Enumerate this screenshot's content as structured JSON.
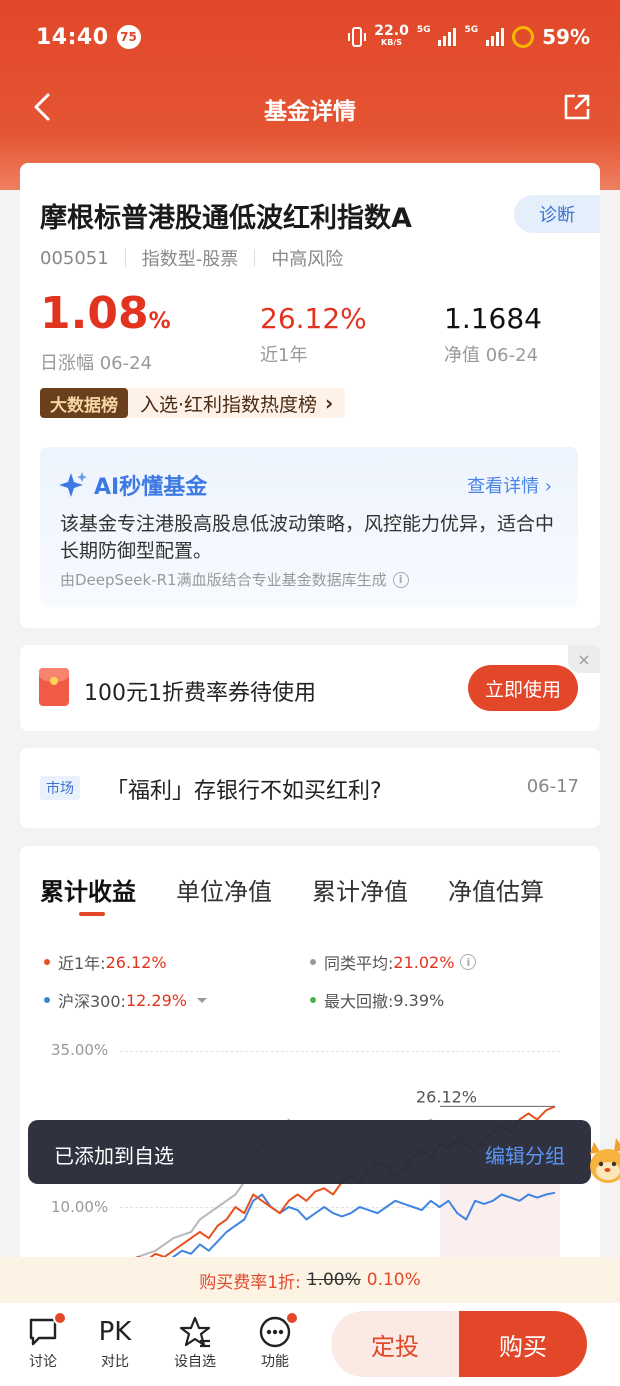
{
  "status_bar": {
    "time": "14:40",
    "notif_count": "75",
    "net_speed": "22.0",
    "net_unit": "KB/S",
    "sim1": "5G",
    "sim2": "5G",
    "battery": "59%"
  },
  "nav": {
    "title": "基金详情",
    "back_icon": "back-arrow-icon",
    "share_icon": "share-icon"
  },
  "fund": {
    "name": "摩根标普港股通低波红利指数A",
    "diagnose_label": "诊断",
    "code": "005051",
    "type": "指数型-股票",
    "risk": "中高风险",
    "daily_change_value": "1.08",
    "daily_change_unit": "%",
    "daily_change_label": "日涨幅 06-24",
    "one_year_value": "26.12%",
    "one_year_label": "近1年",
    "nav_value": "1.1684",
    "nav_label": "净值 06-24",
    "rank_tag": "大数据榜",
    "rank_text": "入选·红利指数热度榜",
    "rank_arrow": "›"
  },
  "ai": {
    "title": "AI秒懂基金",
    "more": "查看详情 ›",
    "body": "该基金专注港股高股息低波动策略，风控能力优异，适合中长期防御型配置。",
    "source": "由DeepSeek-R1满血版结合专业基金数据库生成"
  },
  "coupon": {
    "text": "100元1折费率券待使用",
    "button": "立即使用",
    "close": "×"
  },
  "news": {
    "tag": "市场",
    "title": "「福利」存银行不如买红利?",
    "date": "06-17"
  },
  "chart_tabs": [
    "累计收益",
    "单位净值",
    "累计净值",
    "净值估算"
  ],
  "legend": {
    "near_year_label": "近1年:",
    "near_year_value": "26.12%",
    "peer_avg_label": "同类平均:",
    "peer_avg_value": "21.02%",
    "hs300_label": "沪深300:",
    "hs300_value": "12.29%",
    "max_dd_label": "最大回撤:",
    "max_dd_value": "9.39%"
  },
  "chart_data": {
    "type": "line",
    "yticks": [
      "35.00%",
      "10.00%"
    ],
    "yticks_values": [
      35,
      22.5,
      10
    ],
    "ylim": [
      0,
      35
    ],
    "end_label": "26.12%",
    "series": [
      {
        "name": "近1年",
        "color": "#e8511f",
        "values": [
          0.5,
          1,
          2,
          1.5,
          2.5,
          2,
          3,
          4,
          5,
          6,
          5,
          7,
          8,
          10,
          9,
          12,
          11,
          10,
          9,
          11,
          12,
          11,
          12.5,
          13,
          12,
          14,
          15,
          14,
          16,
          17,
          16.5,
          15,
          16,
          18,
          19,
          18,
          20,
          19.5,
          21,
          20,
          19,
          20.5,
          22,
          23,
          22,
          24,
          25,
          24,
          25.5,
          26.12
        ]
      },
      {
        "name": "同类平均",
        "color": "#b8b8b8",
        "values": [
          0.5,
          1.5,
          2,
          2.5,
          3,
          4,
          5,
          5.5,
          6,
          8,
          9,
          10,
          11,
          12,
          14,
          18,
          20,
          19,
          22,
          24,
          20,
          18,
          16,
          17,
          18,
          19,
          17,
          16,
          18,
          17,
          19,
          20,
          22,
          21,
          23,
          24,
          22,
          21,
          20,
          22,
          21,
          20,
          19,
          18,
          19,
          21,
          20,
          21,
          21,
          21.02
        ]
      },
      {
        "name": "沪深300",
        "color": "#3f85e0",
        "values": [
          0,
          0.5,
          1,
          0.5,
          1.5,
          1,
          2,
          3,
          2.5,
          4,
          3,
          4.5,
          6,
          7,
          8,
          11,
          12,
          10,
          9,
          10,
          9.5,
          8,
          9,
          10,
          9,
          8.5,
          9,
          10,
          9.5,
          9,
          10,
          11,
          10.5,
          10,
          9.5,
          11,
          10,
          11,
          9,
          8,
          11,
          10.5,
          11,
          12,
          11.5,
          11,
          12,
          11.5,
          12,
          12.29
        ]
      }
    ]
  },
  "toast": {
    "message": "已添加到自选",
    "action": "编辑分组"
  },
  "fee_bar": {
    "label": "购买费率1折:",
    "original": "1.00%",
    "discount": "0.10%"
  },
  "bottom_nav": [
    {
      "label": "讨论",
      "icon": "comment-icon"
    },
    {
      "label": "对比",
      "icon": "pk-icon",
      "glyph": "PK"
    },
    {
      "label": "设自选",
      "icon": "star-icon"
    },
    {
      "label": "功能",
      "icon": "more-icon"
    }
  ],
  "buttons": {
    "plan": "定投",
    "buy": "购买"
  }
}
